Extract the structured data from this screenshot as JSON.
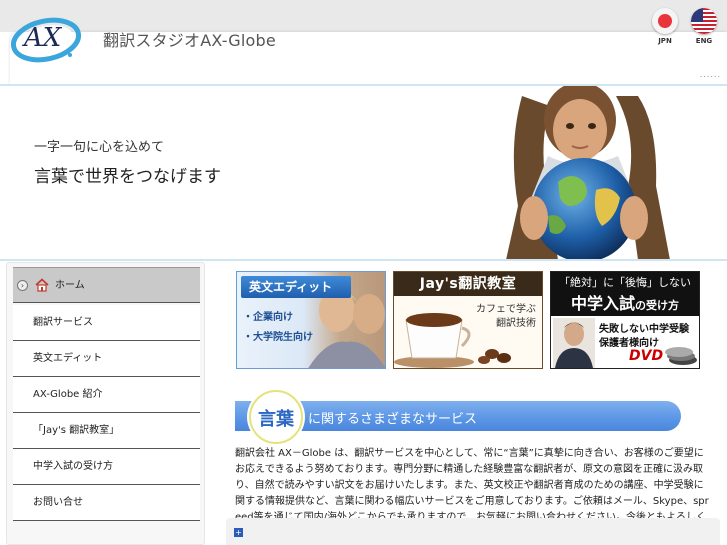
{
  "header": {
    "logo_text": "AX",
    "site_title": "翻訳スタジオAX-Globe",
    "lang_jpn": "JPN",
    "lang_eng": "ENG",
    "dots": "......"
  },
  "hero": {
    "subtitle": "一字一句に心を込めて",
    "headline": "言葉で世界をつなげます"
  },
  "sidebar": {
    "items": [
      {
        "label": "ホーム"
      },
      {
        "label": "翻訳サービス"
      },
      {
        "label": "英文エディット"
      },
      {
        "label": "AX-Globe 紹介"
      },
      {
        "label": "「Jay's 翻訳教室」"
      },
      {
        "label": "中学入試の受け方"
      },
      {
        "label": "お問い合せ"
      }
    ]
  },
  "banners": {
    "b1": {
      "title": "英文エディット",
      "item1": "・企業向け",
      "item2": "・大学院生向け"
    },
    "b2": {
      "title": "Jay's翻訳教室",
      "sub1": "カフェで学ぶ",
      "sub2": "翻訳技術"
    },
    "b3": {
      "line1": "「絶対」に「後悔」しない",
      "line2_big": "中学入試",
      "line2_small": "の受け方",
      "line3": "失敗しない中学受験",
      "line4": "保護者様向け",
      "dvd": "DVD"
    }
  },
  "services": {
    "word": "言葉",
    "heading": "に関するさまざまなサービス",
    "body": "翻訳会社 AX－Globe は、翻訳サービスを中心として、常に“言葉”に真摯に向き合い、お客様のご要望にお応えできるよう努めております。専門分野に精通した経験豊富な翻訳者が、原文の意図を正確に汲み取り、自然で読みやすい訳文をお届けいたします。また、英文校正や翻訳者育成のための講座、中学受験に関する情報提供など、言葉に関わる幅広いサービスをご用意しております。ご依頼はメール、Skype、spreed等を通じて国内/海外どこからでも承りますので、お気軽にお問い合わせください。今後ともよろしくお願い申し上げます。"
  },
  "colors": {
    "accent": "#4a86dc",
    "header_bg": "#e9e9e9",
    "rule": "#cfe6f2"
  }
}
